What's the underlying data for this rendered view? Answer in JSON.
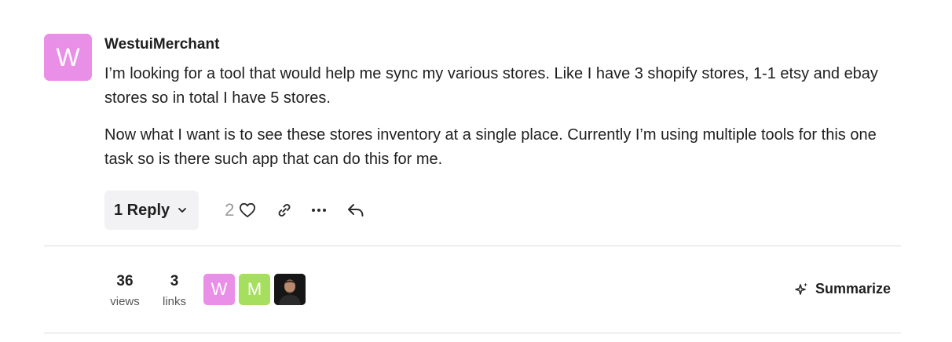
{
  "post": {
    "avatar_letter": "W",
    "avatar_color": "#ea8fe8",
    "username": "WestuiMerchant",
    "paragraphs": [
      "I’m looking for a tool that would help me sync my various stores. Like I have 3 shopify stores, 1-1 etsy and ebay stores so in total I have 5 stores.",
      "Now what I want is to see these stores inventory at a single place. Currently I’m using multiple tools for this one task so is there such app that can do this for me."
    ],
    "reply_label": "1 Reply",
    "like_count": "2",
    "icons": [
      "chevron-down-icon",
      "heart-icon",
      "link-icon",
      "ellipsis-icon",
      "reply-icon"
    ]
  },
  "stats": {
    "views_count": "36",
    "views_label": "views",
    "links_count": "3",
    "links_label": "links"
  },
  "participants": [
    {
      "letter": "W",
      "color": "#ea8fe8"
    },
    {
      "letter": "M",
      "color": "#a6df5e"
    },
    {
      "letter": "",
      "color": "#1b1b1b"
    }
  ],
  "summarize_label": "Summarize"
}
